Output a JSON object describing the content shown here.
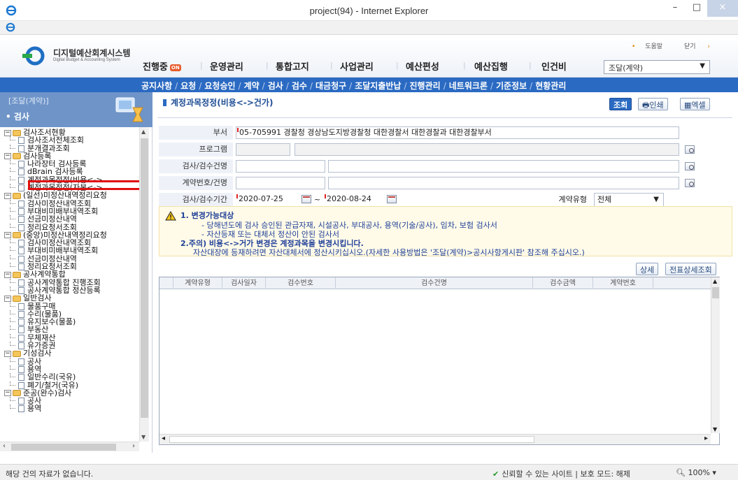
{
  "browser": {
    "window_title": "project(94) - Internet Explorer",
    "minimize": "–",
    "maximize": "□",
    "close": "×"
  },
  "app": {
    "name": "디지털예산회계시스템",
    "subtitle": "Digital Budget & Accounting System",
    "top_links": [
      "도움말",
      "닫기"
    ],
    "menu": [
      {
        "label": "진행중",
        "badge": "ON"
      },
      {
        "label": "운영관리"
      },
      {
        "label": "통합고지"
      },
      {
        "label": "사업관리"
      },
      {
        "label": "예산편성"
      },
      {
        "label": "예산집행"
      },
      {
        "label": "인건비"
      }
    ],
    "dept_select": "조달(계약)",
    "submenu": [
      "공지사항",
      "요청",
      "요청승인",
      "계약",
      "검사",
      "검수",
      "대금청구",
      "조달지출반납",
      "진행관리",
      "네트워크론",
      "기준정보",
      "현황관리"
    ]
  },
  "sidebar": {
    "crumb": "[조달(계약)]",
    "section": "검사",
    "tree": [
      {
        "level": 0,
        "type": "folder",
        "label": "검사조서현황"
      },
      {
        "level": 1,
        "type": "doc",
        "label": "검사조서전체조회"
      },
      {
        "level": 1,
        "type": "doc",
        "label": "분개결과조회"
      },
      {
        "level": 0,
        "type": "folder",
        "label": "검사등록"
      },
      {
        "level": 1,
        "type": "doc",
        "label": "나라장터 검사등록"
      },
      {
        "level": 1,
        "type": "doc",
        "label": "dBrain 검사등록"
      },
      {
        "level": 1,
        "type": "doc",
        "label": "계정과목정정(비용<->"
      },
      {
        "level": 1,
        "type": "doc",
        "label": "계정과목정정(자본<->"
      },
      {
        "level": 0,
        "type": "folder",
        "label": "(일선)미정산내역정리요청"
      },
      {
        "level": 1,
        "type": "doc",
        "label": "검사미정산내역조회"
      },
      {
        "level": 1,
        "type": "doc",
        "label": "부대비미배부내역조회"
      },
      {
        "level": 1,
        "type": "doc",
        "label": "선금미정산내역"
      },
      {
        "level": 1,
        "type": "doc",
        "label": "정리요청서조회"
      },
      {
        "level": 0,
        "type": "folder",
        "label": "(중앙)미정산내역정리요청"
      },
      {
        "level": 1,
        "type": "doc",
        "label": "검사미정산내역조회"
      },
      {
        "level": 1,
        "type": "doc",
        "label": "부대비미배부내역조회"
      },
      {
        "level": 1,
        "type": "doc",
        "label": "선금미정산내역"
      },
      {
        "level": 1,
        "type": "doc",
        "label": "정리요청서조회"
      },
      {
        "level": 0,
        "type": "folder",
        "label": "공사계약통합"
      },
      {
        "level": 1,
        "type": "doc",
        "label": "공사계약통합 진행조회"
      },
      {
        "level": 1,
        "type": "doc",
        "label": "공사계약통합 정산등록"
      },
      {
        "level": 0,
        "type": "folder",
        "label": "일반검사"
      },
      {
        "level": 1,
        "type": "doc",
        "label": "물품구매"
      },
      {
        "level": 1,
        "type": "doc",
        "label": "수리(물품)"
      },
      {
        "level": 1,
        "type": "doc",
        "label": "유지보수(물품)"
      },
      {
        "level": 1,
        "type": "doc",
        "label": "부동산"
      },
      {
        "level": 1,
        "type": "doc",
        "label": "무체재산"
      },
      {
        "level": 1,
        "type": "doc",
        "label": "유가증권"
      },
      {
        "level": 0,
        "type": "folder",
        "label": "기성검사"
      },
      {
        "level": 1,
        "type": "doc",
        "label": "공사"
      },
      {
        "level": 1,
        "type": "doc",
        "label": "용역"
      },
      {
        "level": 1,
        "type": "doc",
        "label": "일반수리(국유)"
      },
      {
        "level": 1,
        "type": "doc",
        "label": "폐기/철거(국유)"
      },
      {
        "level": 0,
        "type": "folder",
        "label": "준공(완수)검사"
      },
      {
        "level": 1,
        "type": "doc",
        "label": "공사"
      },
      {
        "level": 1,
        "type": "doc",
        "label": "용역"
      }
    ]
  },
  "page": {
    "title": "계정과목정정(비용<->건가)",
    "buttons": {
      "search": "조회",
      "print": "인쇄",
      "excel": "엑셀"
    },
    "form": {
      "dept_label": "부서",
      "dept_value": "05-705991 경찰청 경상남도지방경찰청 대한경찰서 대한경찰과 대한경찰부서",
      "program_label": "프로그램",
      "insp_name_label": "검사/검수건명",
      "contract_label": "계약번호/건명",
      "period_label": "검사/검수기간",
      "date_from": "2020-07-25",
      "tilde": "~",
      "date_to": "2020-08-24",
      "contract_type_label": "계약유형",
      "contract_type_value": "전체"
    },
    "notice": {
      "line1": "1. 변경가능대상",
      "line2": "- 당해년도에 검사 승인된 관급자재, 시설공사, 부대공사, 용역(기술/공사), 임차, 보험 검사서",
      "line3": "- 자산등재 또는 대체서 정산이 안된 검사서",
      "line4": "2.주의) 비용<->거가 변경은 계정과목을 변경시킵니다.",
      "line5": "자산대장에 등재하려면 자산대체서에 정산시키십시오.(자세한 사용방법은 '조달(계약)>공시사항게시판' 참조해 주십시오.)"
    },
    "grid_buttons": {
      "detail": "상세",
      "voucher": "전표상세조회"
    },
    "grid_columns": [
      "계약유형",
      "검사일자",
      "검수번호",
      "검수건명",
      "검수금액",
      "계약번호"
    ]
  },
  "status": {
    "message": "해당 건의 자료가 없습니다.",
    "trust": "신뢰할 수 있는 사이트 | 보호 모드: 해제",
    "zoom": "100%"
  },
  "colors": {
    "accent": "#2b6ac2",
    "highlight": "#e01010",
    "notice_bg": "#fffbe8"
  }
}
